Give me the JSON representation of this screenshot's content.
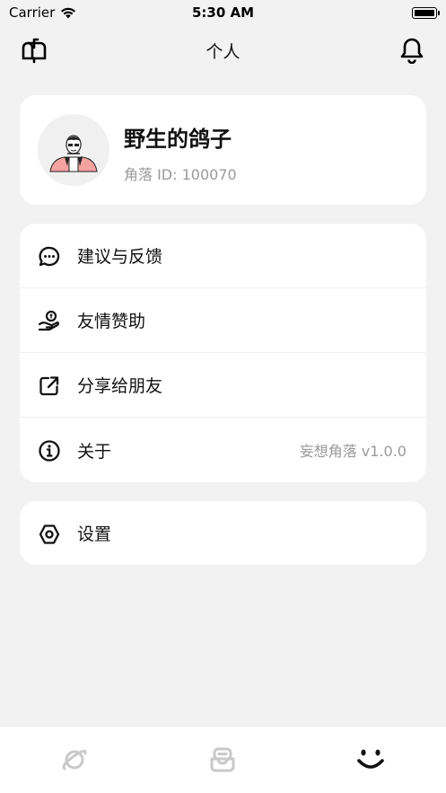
{
  "status": {
    "carrier": "Carrier",
    "time": "5:30 AM"
  },
  "nav": {
    "title": "个人",
    "left_icon": "mailbox-icon",
    "right_icon": "bell-icon"
  },
  "profile": {
    "name": "野生的鸽子",
    "id_text": "角落 ID: 100070"
  },
  "menu": {
    "items": [
      {
        "label": "建议与反馈",
        "icon": "chat-bubble-icon"
      },
      {
        "label": "友情赞助",
        "icon": "donate-hand-icon"
      },
      {
        "label": "分享给朋友",
        "icon": "share-icon"
      },
      {
        "label": "关于",
        "icon": "info-icon",
        "value": "妄想角落 v1.0.0"
      }
    ]
  },
  "settings": {
    "label": "设置",
    "icon": "hexagon-settings-icon"
  },
  "tabs": [
    {
      "icon": "planet-icon",
      "active": false
    },
    {
      "icon": "inbox-tray-icon",
      "active": false
    },
    {
      "icon": "smile-icon",
      "active": true
    }
  ],
  "colors": {
    "background": "#f2f2f2",
    "card": "#ffffff",
    "text": "#111111",
    "muted": "#999999",
    "inactive_tab": "#c9c9c9",
    "avatar_accent": "#f4a3a0"
  }
}
